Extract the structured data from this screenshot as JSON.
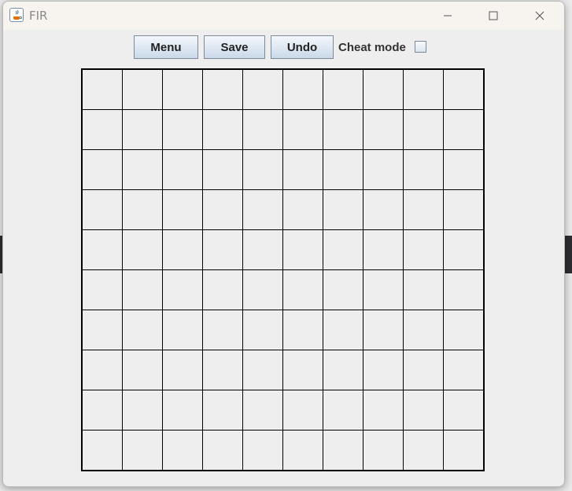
{
  "window": {
    "title": "FIR",
    "app_icon": "java-icon",
    "controls": [
      "minimize-icon",
      "maximize-icon",
      "close-icon"
    ]
  },
  "toolbar": {
    "menu_label": "Menu",
    "save_label": "Save",
    "undo_label": "Undo",
    "cheat_mode_label": "Cheat mode",
    "cheat_mode_checked": false
  },
  "board": {
    "rows": 10,
    "columns": 10,
    "line_color": "#000000"
  }
}
